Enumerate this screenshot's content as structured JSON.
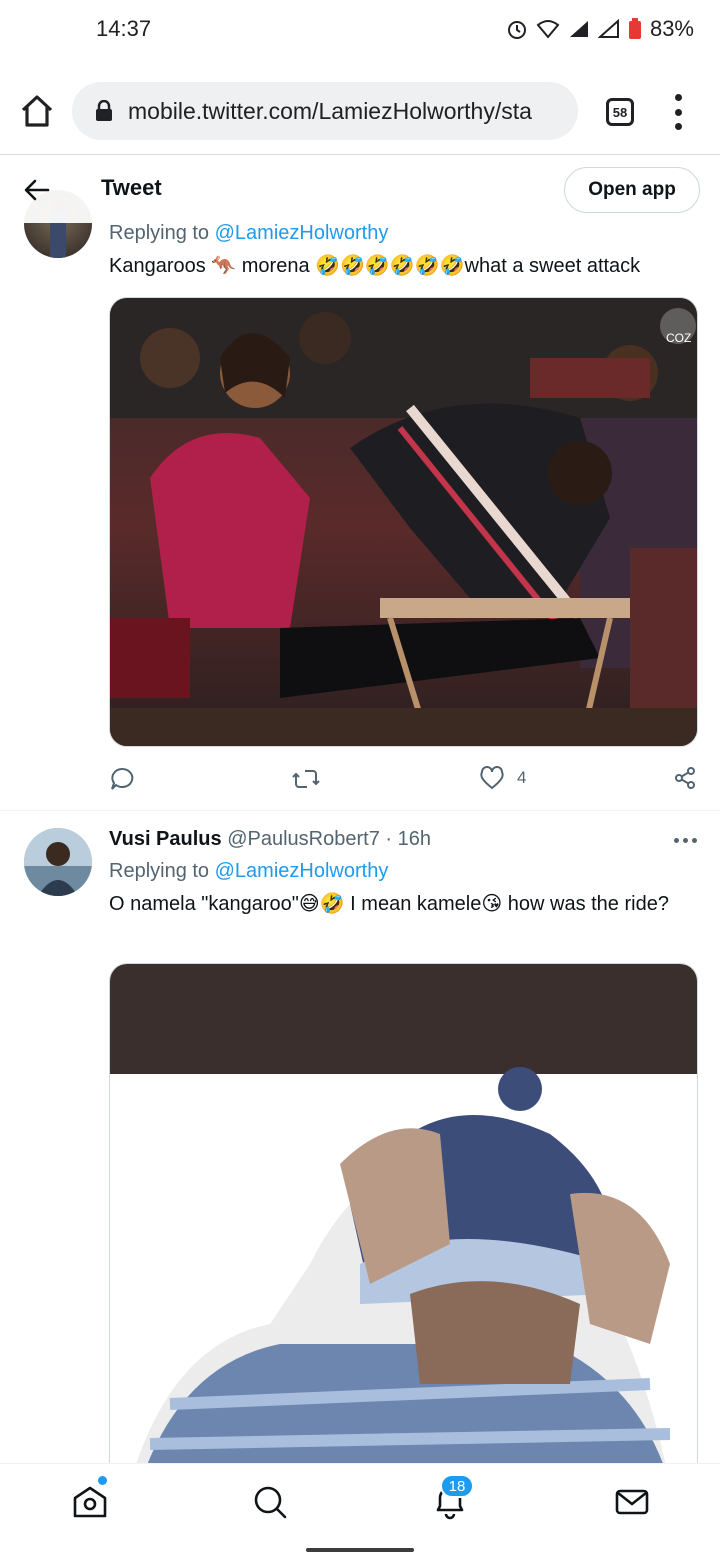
{
  "status_bar": {
    "time": "14:37",
    "battery": "83%",
    "icons": [
      "alarm-icon",
      "wifi-icon",
      "signal-icon",
      "signal-icon",
      "battery-icon"
    ]
  },
  "browser": {
    "url": "mobile.twitter.com/LamiezHolworthy/sta",
    "tab_count": "58",
    "icons": [
      "home-icon",
      "lock-icon",
      "more-vert-icon"
    ]
  },
  "header": {
    "title": "Tweet",
    "open_app_label": "Open app"
  },
  "tweet1": {
    "replying_label": "Replying to",
    "replying_to": "@LamiezHolworthy",
    "text": "Kangaroos 🦘 morena 🤣🤣🤣🤣🤣🤣what a sweet attack",
    "like_count": "4",
    "watermark": "COZ"
  },
  "tweet2": {
    "name": "Vusi Paulus",
    "handle": "@PaulusRobert7",
    "separator": "·",
    "time": "16h",
    "replying_label": "Replying to",
    "replying_to": "@LamiezHolworthy",
    "text": "O namela \"kangaroo\"😅🤣 I mean kamele😘 how was the ride?"
  },
  "bottom_nav": {
    "notification_count": "18",
    "items": [
      "home-icon",
      "search-icon",
      "notifications-icon",
      "messages-icon"
    ]
  },
  "colors": {
    "accent": "#1d9bf0",
    "text_primary": "#0f1419",
    "text_secondary": "#536471"
  }
}
